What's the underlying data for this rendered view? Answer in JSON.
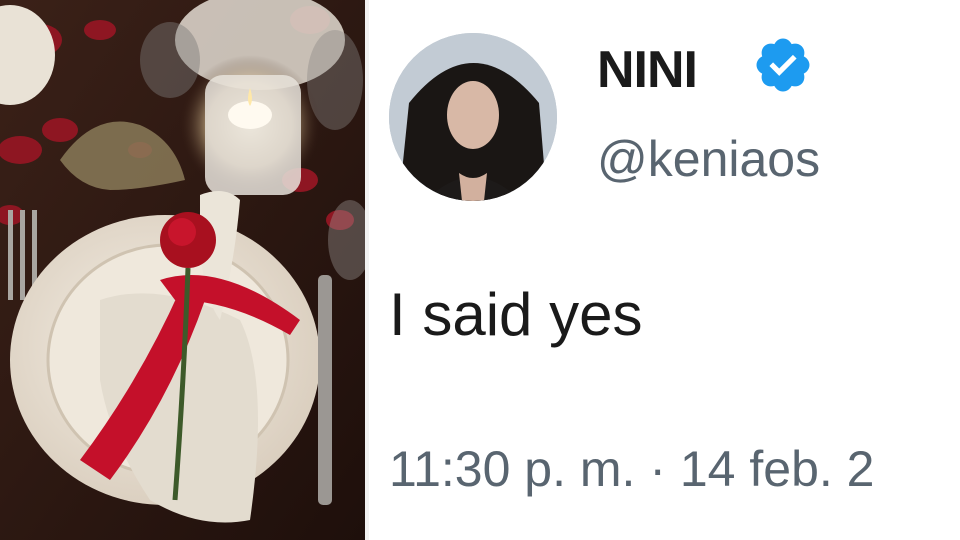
{
  "tweet": {
    "display_name": "NINI",
    "handle": "@keniaos",
    "text": "I said yes",
    "timestamp": "11:30 p. m. · 14 feb. 2",
    "verified": true
  },
  "icons": {
    "verified": "verified-badge-icon"
  },
  "colors": {
    "verified_blue": "#1d9bf0",
    "secondary_text": "#596570",
    "primary_text": "#1a1a1a"
  }
}
